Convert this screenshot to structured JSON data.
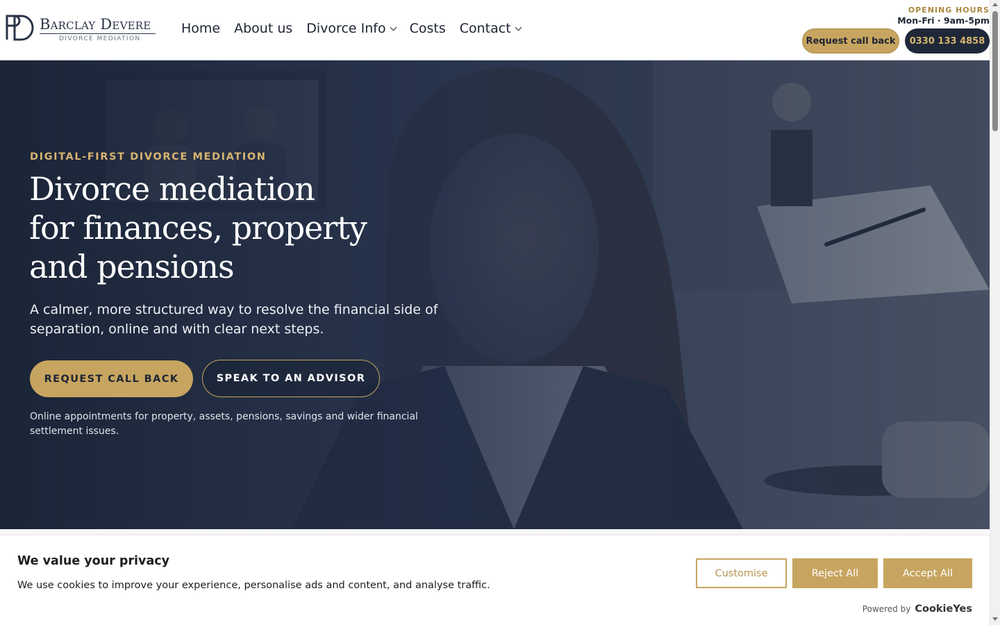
{
  "header": {
    "logo": {
      "monogram": "BD",
      "name": "Barclay Devere",
      "tagline": "DIVORCE MEDIATION"
    },
    "nav": [
      {
        "label": "Home",
        "dropdown": false
      },
      {
        "label": "About us",
        "dropdown": false
      },
      {
        "label": "Divorce Info",
        "dropdown": true
      },
      {
        "label": "Costs",
        "dropdown": false
      },
      {
        "label": "Contact",
        "dropdown": true
      }
    ],
    "hours_label": "OPENING HOURS",
    "hours_value": "Mon-Fri · 9am-5pm",
    "callback_button": "Request call back",
    "phone_button": "0330 133 4858"
  },
  "hero": {
    "eyebrow": "DIGITAL-FIRST DIVORCE MEDIATION",
    "title_lines": [
      "Divorce mediation",
      "for finances, property",
      "and pensions"
    ],
    "description": "A calmer, more structured way to resolve the financial side of separation, online and with clear next steps.",
    "primary_button": "REQUEST CALL BACK",
    "secondary_button": "SPEAK TO AN ADVISOR",
    "note": "Online appointments for property, assets, pensions, savings and wider financial settlement issues."
  },
  "cookie_banner": {
    "title": "We value your privacy",
    "text": "We use cookies to improve your experience, personalise ads and content, and analyse traffic.",
    "customise": "Customise",
    "reject": "Reject All",
    "accept": "Accept All",
    "powered_by": "Powered by",
    "brand": "CookieYes"
  },
  "colors": {
    "gold": "#c7a560",
    "navy": "#1e2838",
    "eyebrow_gold": "#d8b470"
  }
}
